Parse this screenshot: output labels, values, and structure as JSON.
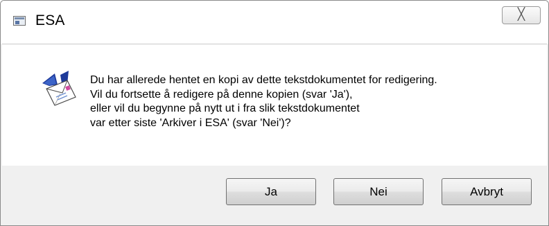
{
  "window": {
    "title": "ESA",
    "close_glyph": "╳"
  },
  "message": {
    "lines": [
      "Du har allerede hentet en kopi av dette tekstdokumentet for redigering.",
      "Vil du fortsette å redigere på denne kopien (svar 'Ja'),",
      "eller vil du begynne på nytt ut i fra slik tekstdokumentet",
      "var etter siste 'Arkiver i ESA' (svar 'Nei')?"
    ],
    "icon": "envelope-question-icon"
  },
  "buttons": {
    "yes": "Ja",
    "no": "Nei",
    "cancel": "Avbryt"
  }
}
